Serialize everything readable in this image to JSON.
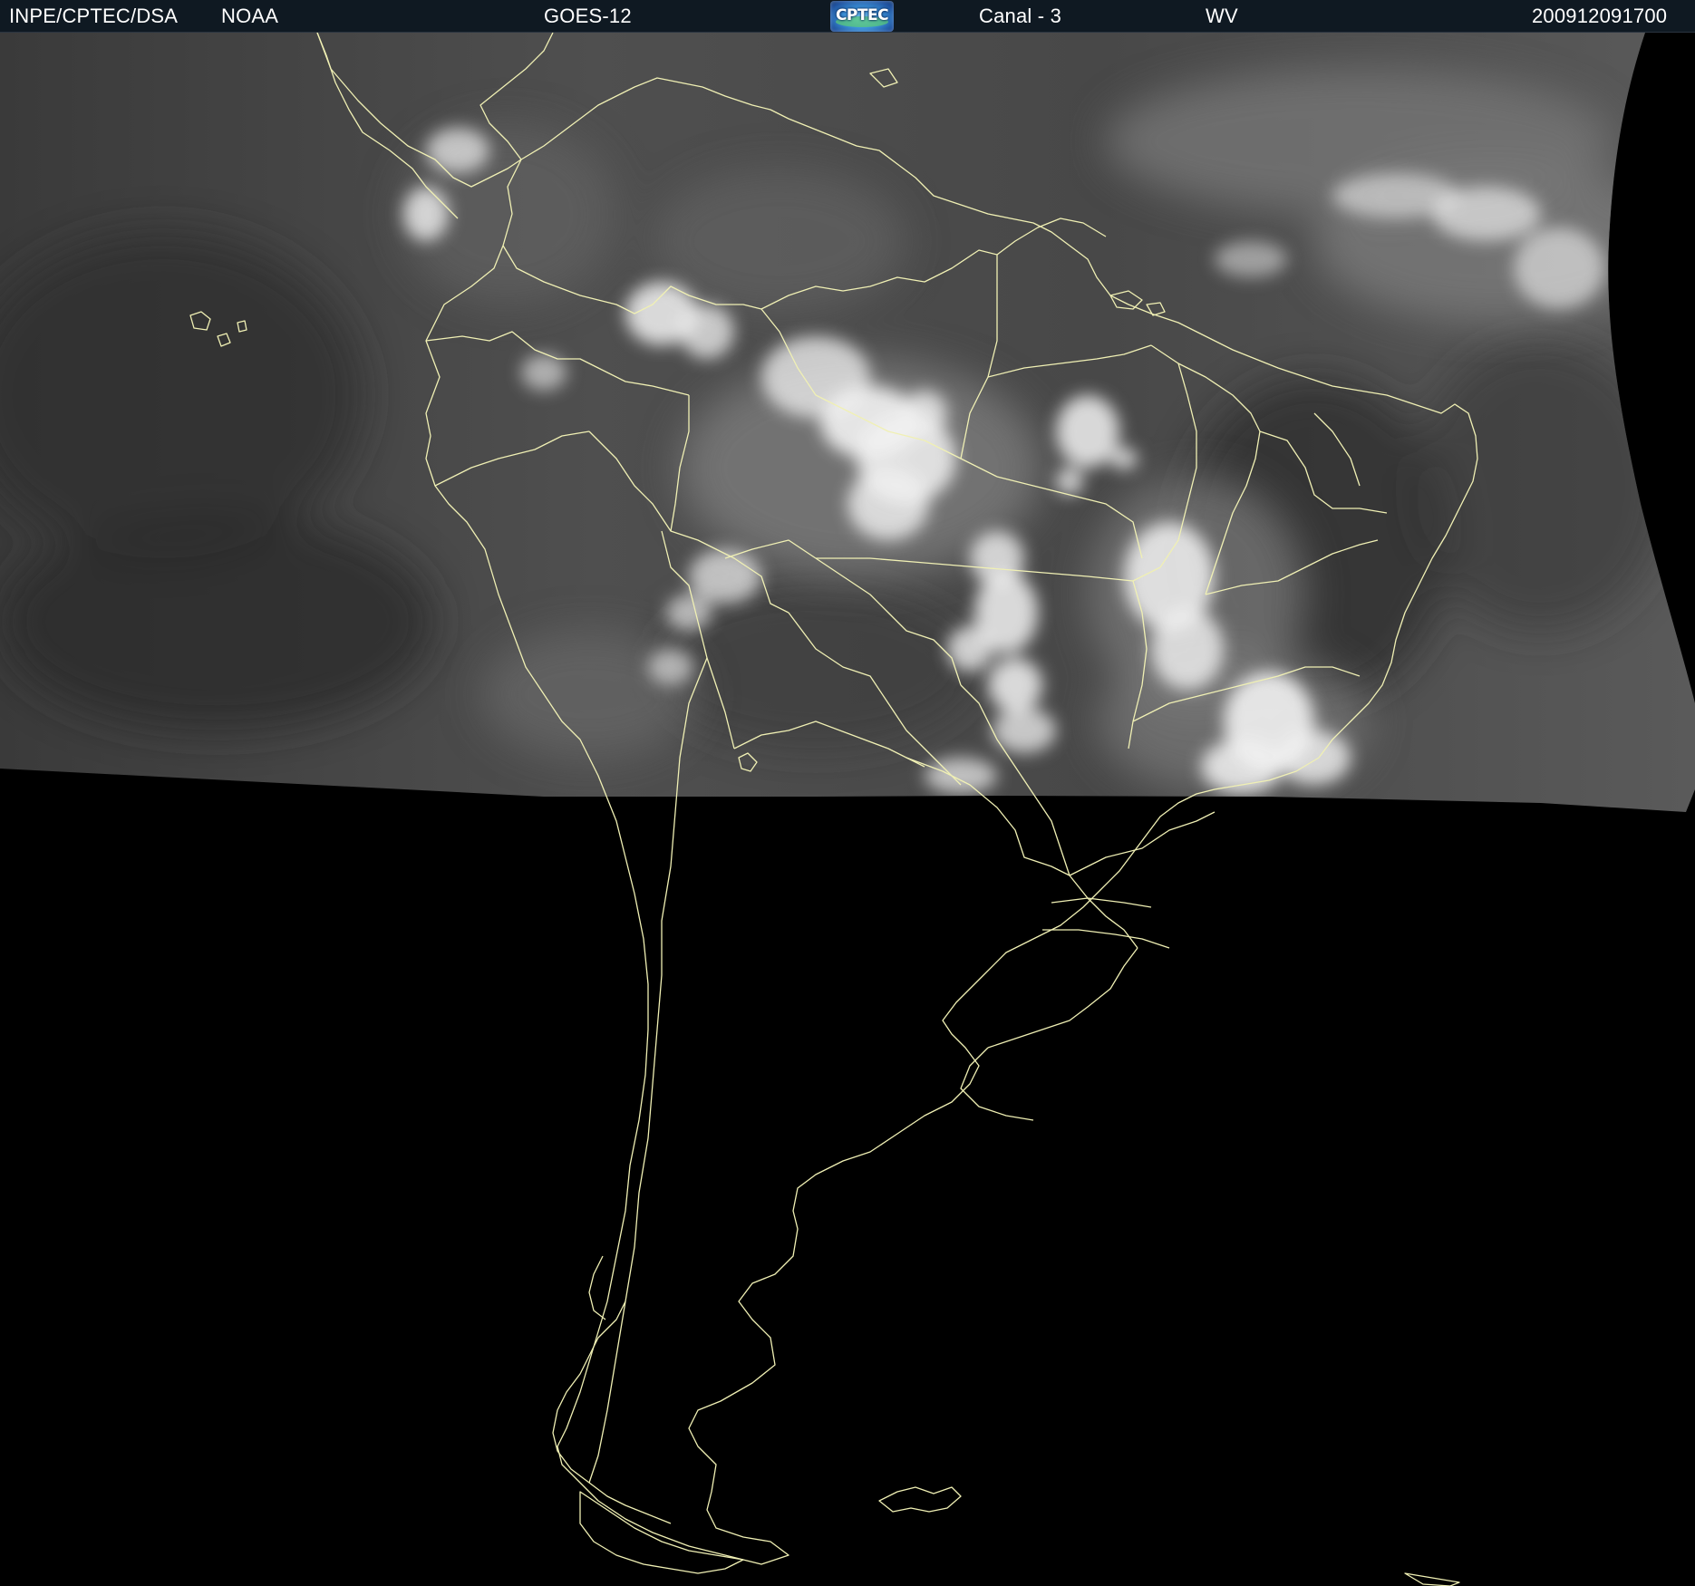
{
  "header": {
    "institution": "INPE/CPTEC/DSA",
    "agency": "NOAA",
    "satellite": "GOES-12",
    "logo_text": "CPTEC",
    "channel": "Canal - 3",
    "band": "WV",
    "timestamp": "200912091700"
  },
  "map": {
    "region": "South America",
    "coverage": "upper half imaged, lower half no data",
    "colors": {
      "background": "#000000",
      "water_vapor_base": "#4a4a4a",
      "cloud": "#f2f2f2",
      "borders": "#f0f0b4",
      "header_bar": "#0f1922",
      "header_text": "#ffffff"
    }
  }
}
